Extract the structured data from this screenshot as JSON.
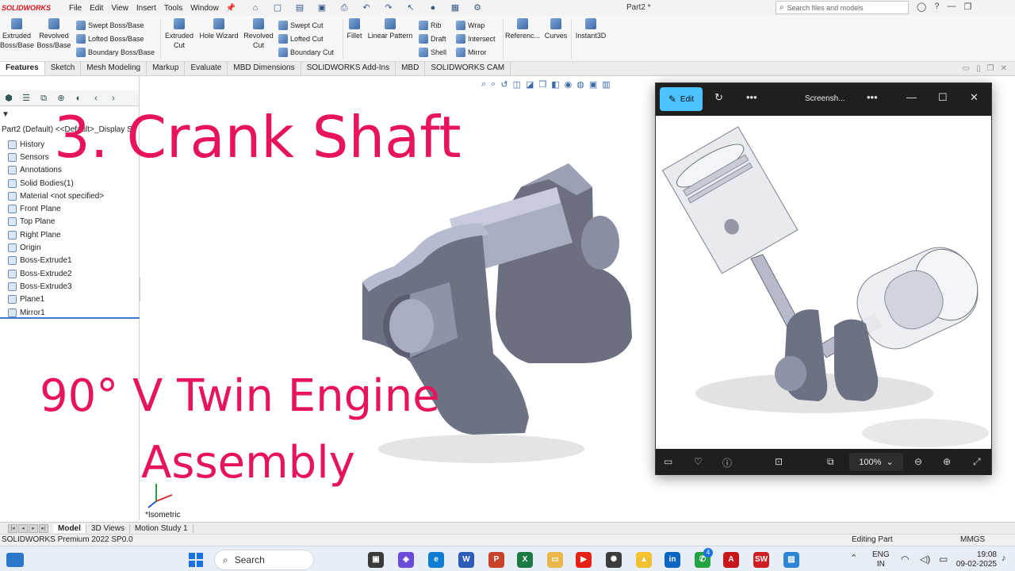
{
  "app": {
    "logo": "SOLIDWORKS",
    "menu": [
      "File",
      "Edit",
      "View",
      "Insert",
      "Tools",
      "Window"
    ],
    "doc_title": "Part2 *",
    "search_placeholder": "Search files and models"
  },
  "ribbon": {
    "extruded_boss": "Extruded Boss/Base",
    "revolved_boss": "Revolved Boss/Base",
    "swept_boss": "Swept Boss/Base",
    "lofted_boss": "Lofted Boss/Base",
    "boundary_boss": "Boundary Boss/Base",
    "extruded_cut": "Extruded Cut",
    "hole_wizard": "Hole Wizard",
    "revolved_cut": "Revolved Cut",
    "swept_cut": "Swept Cut",
    "lofted_cut": "Lofted Cut",
    "boundary_cut": "Boundary Cut",
    "fillet": "Fillet",
    "linear_pattern": "Linear Pattern",
    "rib": "Rib",
    "draft": "Draft",
    "shell": "Shell",
    "wrap": "Wrap",
    "intersect": "Intersect",
    "mirror": "Mirror",
    "reference": "Referenc...",
    "curves": "Curves",
    "instant3d": "Instant3D"
  },
  "command_tabs": [
    "Features",
    "Sketch",
    "Mesh Modeling",
    "Markup",
    "Evaluate",
    "MBD Dimensions",
    "SOLIDWORKS Add-Ins",
    "MBD",
    "SOLIDWORKS CAM"
  ],
  "feature_tree": {
    "root": "Part2 (Default) <<Default>_Display S",
    "items": [
      "History",
      "Sensors",
      "Annotations",
      "Solid Bodies(1)",
      "Material <not specified>",
      "Front Plane",
      "Top Plane",
      "Right Plane",
      "Origin",
      "Boss-Extrude1",
      "Boss-Extrude2",
      "Boss-Extrude3",
      "Plane1",
      "Mirror1"
    ]
  },
  "overlay": {
    "title": "3. Crank Shaft",
    "subtitle_line1": "90° V Twin Engine",
    "subtitle_line2": "Assembly"
  },
  "viewport": {
    "view_label": "*Isometric"
  },
  "photos": {
    "edit_label": "Edit",
    "title": "Screensh...",
    "zoom": "100%"
  },
  "bottom_tabs": [
    "Model",
    "3D Views",
    "Motion Study 1"
  ],
  "status": {
    "left": "SOLIDWORKS Premium 2022 SP0.0",
    "editing": "Editing Part",
    "units": "MMGS"
  },
  "taskbar": {
    "search": "Search",
    "badge": "4",
    "lang_line1": "ENG",
    "lang_line2": "IN",
    "time": "19:08",
    "date": "09-02-2025"
  }
}
